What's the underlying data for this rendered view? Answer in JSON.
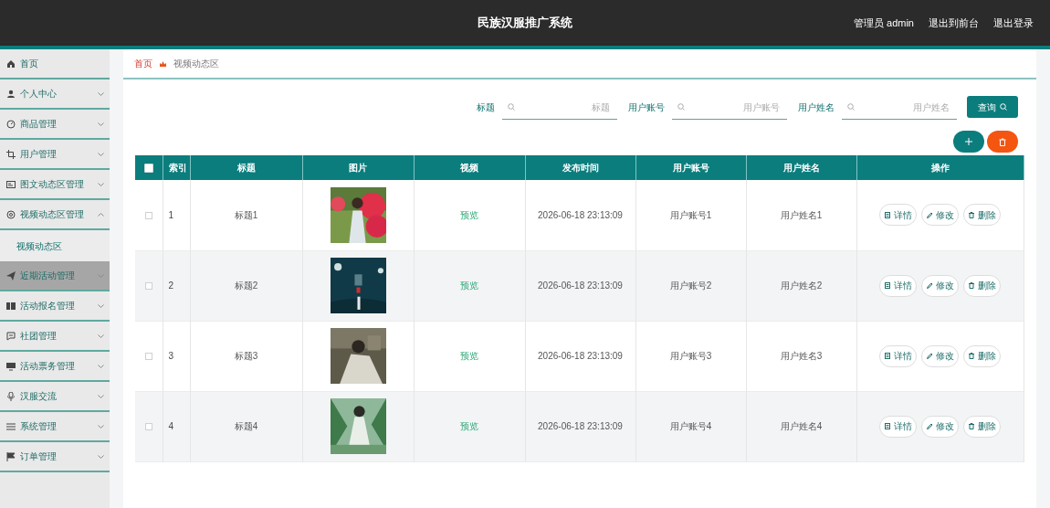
{
  "header": {
    "title": "民族汉服推广系统",
    "links": [
      "管理员 admin",
      "退出到前台",
      "退出登录"
    ]
  },
  "sidebar": {
    "items": [
      {
        "label": "首页",
        "kind": "link",
        "hovered": false
      },
      {
        "label": "个人中心",
        "kind": "menu",
        "expanded": false,
        "hovered": false
      },
      {
        "label": "商品管理",
        "kind": "menu",
        "expanded": false,
        "hovered": false
      },
      {
        "label": "用户管理",
        "kind": "menu",
        "expanded": false,
        "hovered": false
      },
      {
        "label": "图文动态区管理",
        "kind": "menu",
        "expanded": false,
        "hovered": false
      },
      {
        "label": "视频动态区管理",
        "kind": "menu",
        "expanded": true,
        "hovered": false,
        "children": [
          {
            "label": "视频动态区",
            "selected": true
          }
        ]
      },
      {
        "label": "近期活动管理",
        "kind": "menu",
        "expanded": false,
        "hovered": true
      },
      {
        "label": "活动报名管理",
        "kind": "menu",
        "expanded": false,
        "hovered": false
      },
      {
        "label": "社团管理",
        "kind": "menu",
        "expanded": false,
        "hovered": false
      },
      {
        "label": "活动票务管理",
        "kind": "menu",
        "expanded": false,
        "hovered": false
      },
      {
        "label": "汉服交流",
        "kind": "menu",
        "expanded": false,
        "hovered": false
      },
      {
        "label": "系统管理",
        "kind": "menu",
        "expanded": false,
        "hovered": false
      },
      {
        "label": "订单管理",
        "kind": "menu",
        "expanded": false,
        "hovered": false
      }
    ]
  },
  "breadcrumb": [
    "首页",
    "视频动态区"
  ],
  "search": {
    "fields": [
      {
        "label": "标题",
        "placeholder": "标题"
      },
      {
        "label": "用户账号",
        "placeholder": "用户账号"
      },
      {
        "label": "用户姓名",
        "placeholder": "用户姓名"
      }
    ],
    "button": "查询"
  },
  "table": {
    "header_checked": false,
    "columns": [
      "索引",
      "标题",
      "图片",
      "视频",
      "发布时间",
      "用户账号",
      "用户姓名",
      "操作"
    ],
    "rows": [
      {
        "checked": false,
        "index": "1",
        "title": "标题1",
        "picture": {
          "kind": "picture"
        },
        "video": "预览",
        "time": "2026-06-18 23:13:09",
        "account": "用户账号1",
        "name": "用户姓名1",
        "actions": [
          "详情",
          "修改",
          "删除"
        ]
      },
      {
        "checked": false,
        "index": "2",
        "title": "标题2",
        "picture": {
          "kind": "picture"
        },
        "video": "预览",
        "time": "2026-06-18 23:13:09",
        "account": "用户账号2",
        "name": "用户姓名2",
        "actions": [
          "详情",
          "修改",
          "删除"
        ]
      },
      {
        "checked": false,
        "index": "3",
        "title": "标题3",
        "picture": {
          "kind": "picture"
        },
        "video": "预览",
        "time": "2026-06-18 23:13:09",
        "account": "用户账号3",
        "name": "用户姓名3",
        "actions": [
          "详情",
          "修改",
          "删除"
        ]
      },
      {
        "checked": false,
        "index": "4",
        "title": "标题4",
        "picture": {
          "kind": "picture"
        },
        "video": "预览",
        "time": "2026-06-18 23:13:09",
        "account": "用户账号4",
        "name": "用户姓名4",
        "actions": [
          "详情",
          "修改",
          "删除"
        ]
      }
    ]
  }
}
